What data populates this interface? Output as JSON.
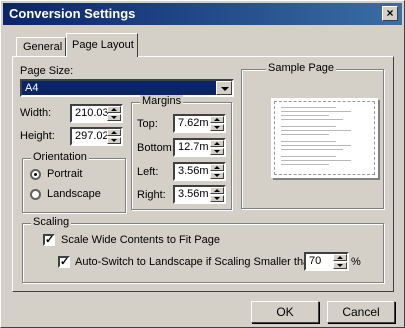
{
  "window": {
    "title": "Conversion Settings",
    "close_glyph": "×"
  },
  "tabs": [
    {
      "label": "General",
      "active": false
    },
    {
      "label": "Page Layout",
      "active": true
    }
  ],
  "page_size": {
    "label": "Page Size:",
    "value": "A4"
  },
  "dimensions": {
    "width_label": "Width:",
    "width_value": "210.03",
    "height_label": "Height:",
    "height_value": "297.02"
  },
  "margins": {
    "title": "Margins",
    "top_label": "Top:",
    "top_value": "7.62m",
    "bottom_label": "Bottom:",
    "bottom_value": "12.7m",
    "left_label": "Left:",
    "left_value": "3.56m",
    "right_label": "Right:",
    "right_value": "3.56m"
  },
  "orientation": {
    "title": "Orientation",
    "portrait_label": "Portrait",
    "landscape_label": "Landscape",
    "selected": "Portrait"
  },
  "sample_page": {
    "title": "Sample Page"
  },
  "scaling": {
    "title": "Scaling",
    "scale_wide_label": "Scale Wide Contents to Fit Page",
    "scale_wide_checked": true,
    "auto_switch_label": "Auto-Switch to Landscape if Scaling Smaller than",
    "auto_switch_checked": true,
    "threshold_value": "70",
    "percent_symbol": "%"
  },
  "buttons": {
    "ok": "OK",
    "cancel": "Cancel"
  },
  "colors": {
    "titlebar": "#0a246a",
    "selection": "#0a246a",
    "face": "#d4d0c8"
  }
}
